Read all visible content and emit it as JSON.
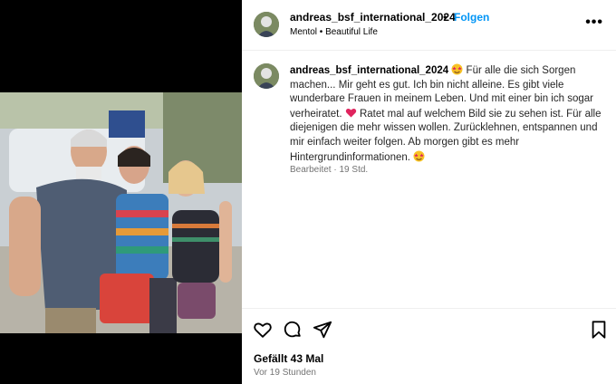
{
  "post": {
    "username": "andreas_bsf_international_2024",
    "separator": "•",
    "follow_label": "Folgen",
    "audio": "Mentol • Beautiful Life",
    "more_label": "•••"
  },
  "caption": {
    "username": "andreas_bsf_international_2024",
    "part1": "Für alle die sich Sorgen machen... Mir geht es gut. Ich bin nicht alleine. Es gibt viele wunderbare Frauen in meinem Leben. Und mit einer bin ich sogar verheiratet.",
    "part2": "Ratet mal auf welchem Bild sie zu sehen ist. Für alle diejenigen die mehr wissen wollen. Zurücklehnen, entspannen und mir einfach weiter folgen. Ab morgen gibt es mehr Hintergrundinformationen.",
    "edited": "Bearbeitet",
    "meta_sep": "·",
    "time": "19 Std."
  },
  "actions": {
    "likes": "Gefällt 43 Mal",
    "posted": "Vor 19 Stunden"
  },
  "icons": {
    "emoji_star_eyes": "star-struck-emoji",
    "heart": "red-heart-emoji",
    "like": "heart-outline-icon",
    "comment": "comment-icon",
    "share": "paper-plane-icon",
    "save": "bookmark-icon",
    "more": "more-options-icon"
  },
  "colors": {
    "link": "#0095f6",
    "muted": "#737373",
    "heart": "#e0245e",
    "emoji": "#f7c325"
  }
}
